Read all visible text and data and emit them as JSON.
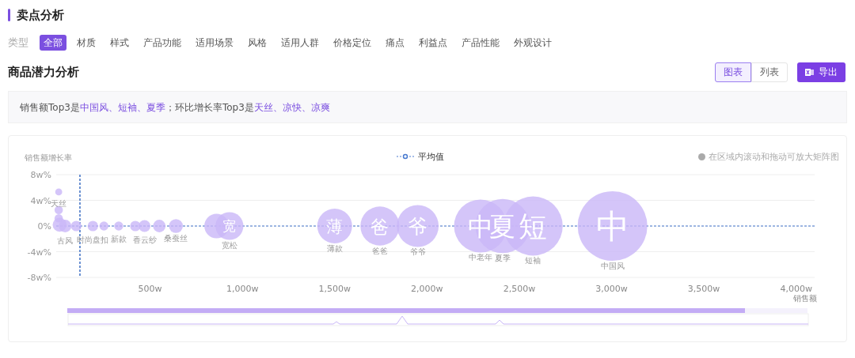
{
  "section_title": "卖点分析",
  "filter": {
    "label": "类型",
    "options": [
      {
        "label": "全部",
        "selected": true
      },
      {
        "label": "材质",
        "selected": false
      },
      {
        "label": "样式",
        "selected": false
      },
      {
        "label": "产品功能",
        "selected": false
      },
      {
        "label": "适用场景",
        "selected": false
      },
      {
        "label": "风格",
        "selected": false
      },
      {
        "label": "适用人群",
        "selected": false
      },
      {
        "label": "价格定位",
        "selected": false
      },
      {
        "label": "痛点",
        "selected": false
      },
      {
        "label": "利益点",
        "selected": false
      },
      {
        "label": "产品性能",
        "selected": false
      },
      {
        "label": "外观设计",
        "selected": false
      }
    ]
  },
  "panel_title": "商品潜力分析",
  "view_toggle": [
    {
      "label": "图表",
      "selected": true
    },
    {
      "label": "列表",
      "selected": false
    }
  ],
  "export_button": "导出",
  "summary": [
    {
      "text": "销售额Top3是",
      "highlight": false
    },
    {
      "text": "中国风、短袖、夏季",
      "highlight": true
    },
    {
      "text": "；环比增长率Top3是",
      "highlight": false
    },
    {
      "text": "天丝、凉快、凉爽",
      "highlight": true
    }
  ],
  "chart": {
    "hint": "在区域内滚动和拖动可放大矩阵图",
    "data_zoom": {
      "level": 0.915
    },
    "chart_data": {
      "type": "scatter",
      "xlabel": "销售额",
      "ylabel": "销售额增长率",
      "xlim": [
        0,
        4100
      ],
      "ylim": [
        -8,
        8
      ],
      "xticks": [
        {
          "value": 500,
          "label": "500w"
        },
        {
          "value": 1000,
          "label": "1,000w"
        },
        {
          "value": 1500,
          "label": "1,500w"
        },
        {
          "value": 2000,
          "label": "2,000w"
        },
        {
          "value": 2500,
          "label": "2,500w"
        },
        {
          "value": 3000,
          "label": "3,000w"
        },
        {
          "value": 3500,
          "label": "3,500w"
        },
        {
          "value": 4000,
          "label": "4,000w"
        }
      ],
      "yticks": [
        {
          "value": 8,
          "label": "8w%"
        },
        {
          "value": 4,
          "label": "4w%"
        },
        {
          "value": 0,
          "label": "0%"
        },
        {
          "value": -4,
          "label": "-4w%"
        },
        {
          "value": -8,
          "label": "-8w%"
        }
      ],
      "x": [
        5,
        5,
        5,
        10,
        40,
        100,
        190,
        250,
        330,
        420,
        470,
        550,
        640,
        860,
        930,
        1500,
        1745,
        1950,
        2290,
        2410,
        2575,
        3005
      ],
      "series": [
        {
          "color": "#c9b6f7",
          "values": [
            5.3,
            2.5,
            1.2,
            0.2,
            0,
            0,
            0,
            0,
            0,
            0,
            0,
            0,
            0,
            0,
            0,
            0,
            0,
            0,
            0,
            0,
            0,
            0
          ],
          "sizes": [
            0.01,
            0.0144,
            0.0144,
            0.04,
            0.0324,
            0.0225,
            0.0225,
            0.0169,
            0.0169,
            0.0225,
            0.0289,
            0.0324,
            0.04,
            0.1225,
            0.16,
            0.25,
            0.3136,
            0.36,
            0.5776,
            0.6084,
            0.7225,
            1.0
          ]
        }
      ],
      "ref_lines": [
        {
          "axis": "x",
          "value": 120,
          "label": "平均值"
        },
        {
          "axis": "y",
          "value": 0
        }
      ],
      "annotations": [
        {
          "x": 5,
          "y": 5.3,
          "text": "天丝"
        },
        {
          "x": 40,
          "y": 0,
          "text": "古风"
        },
        {
          "x": 190,
          "y": 0,
          "text": "时尚盘扣"
        },
        {
          "x": 330,
          "y": 0,
          "text": "新款"
        },
        {
          "x": 470,
          "y": 0,
          "text": "香云纱"
        },
        {
          "x": 640,
          "y": 0,
          "text": "桑蚕丝"
        },
        {
          "x": 930,
          "y": 0,
          "text": "宽松"
        },
        {
          "x": 1500,
          "y": 0,
          "text": "薄款"
        },
        {
          "x": 1745,
          "y": 0,
          "text": "爸爸"
        },
        {
          "x": 1950,
          "y": 0,
          "text": "爷爷"
        },
        {
          "x": 2290,
          "y": -4.1,
          "text": "中老年"
        },
        {
          "x": 2410,
          "y": -4.2,
          "text": "夏季"
        },
        {
          "x": 2575,
          "y": -4.6,
          "text": "短袖"
        },
        {
          "x": 3005,
          "y": -5.4,
          "text": "中国风"
        },
        {
          "x": 930,
          "y": 0,
          "text": "宽"
        },
        {
          "x": 1500,
          "y": 0,
          "text": "薄"
        },
        {
          "x": 1745,
          "y": 0,
          "text": "爸"
        },
        {
          "x": 1950,
          "y": 0,
          "text": "爷"
        },
        {
          "x": 2290,
          "y": 0,
          "text": "中"
        },
        {
          "x": 2410,
          "y": 0,
          "text": "夏"
        },
        {
          "x": 2575,
          "y": 0,
          "text": "短"
        },
        {
          "x": 3005,
          "y": 0,
          "text": "中"
        }
      ]
    }
  }
}
